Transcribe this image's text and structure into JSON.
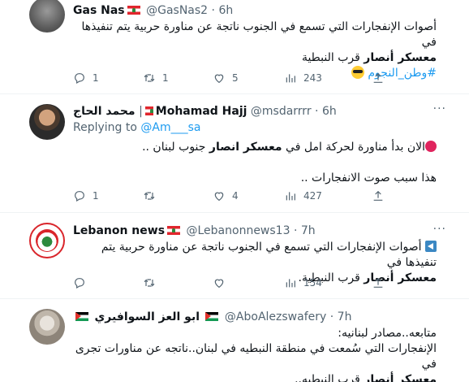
{
  "tweets": [
    {
      "name": "Gas Nas",
      "handle": "@GasNas2",
      "time": "6h",
      "body": [
        "أصوات الإنفجارات التي تسمع في الجنوب ناتجة عن مناورة حربية يتم تنفيذها في",
        {
          "bold": "معسكر أنصار",
          "rest": " قرب النبطية"
        }
      ],
      "hashtag": "#وطن_النجوم",
      "stats": {
        "replies": "1",
        "retweets": "1",
        "likes": "5",
        "views": "243"
      }
    },
    {
      "name": "Mohamad Hajj",
      "name_ar": "محمد الحاج",
      "handle": "@msdarrrr",
      "time": "6h",
      "reply_prefix": "Replying to",
      "reply_to": "@Am___sa",
      "body_line1_pre": "الان بدأ مناورة لحركة امل في ",
      "body_line1_bold": "معسكر انصار",
      "body_line1_post": " جنوب لبنان ..",
      "body_line2": "هذا سبب صوت الانفجارات ..",
      "stats": {
        "replies": "1",
        "retweets": "",
        "likes": "4",
        "views": "427"
      }
    },
    {
      "name": "Lebanon news",
      "handle": "@Lebanonnews13",
      "time": "7h",
      "body_line1": "أصوات الإنفجارات التي تسمع في الجنوب ناتجة عن مناورة حربية يتم تنفيذها في",
      "body_line2_bold": "معسكر أنصار",
      "body_line2_rest": " قرب النبطية.",
      "stats": {
        "replies": "",
        "retweets": "",
        "likes": "",
        "views": "154"
      }
    },
    {
      "name": "ابو العز السوافيري",
      "handle": "@AboAlezswafery",
      "time": "7h",
      "body_line1": "متابعه..مصادر لبنانيه:",
      "body_line2": "الإنفجارات التي سُمعت في منطقة النبطيه في لبنان..ناتجه عن مناورات تجرى في",
      "body_line3_bold": "معسكر أنصار",
      "body_line3_rest": " قرب النبطيه.."
    }
  ],
  "ui": {
    "more_glyph": "···",
    "dot": "·"
  }
}
